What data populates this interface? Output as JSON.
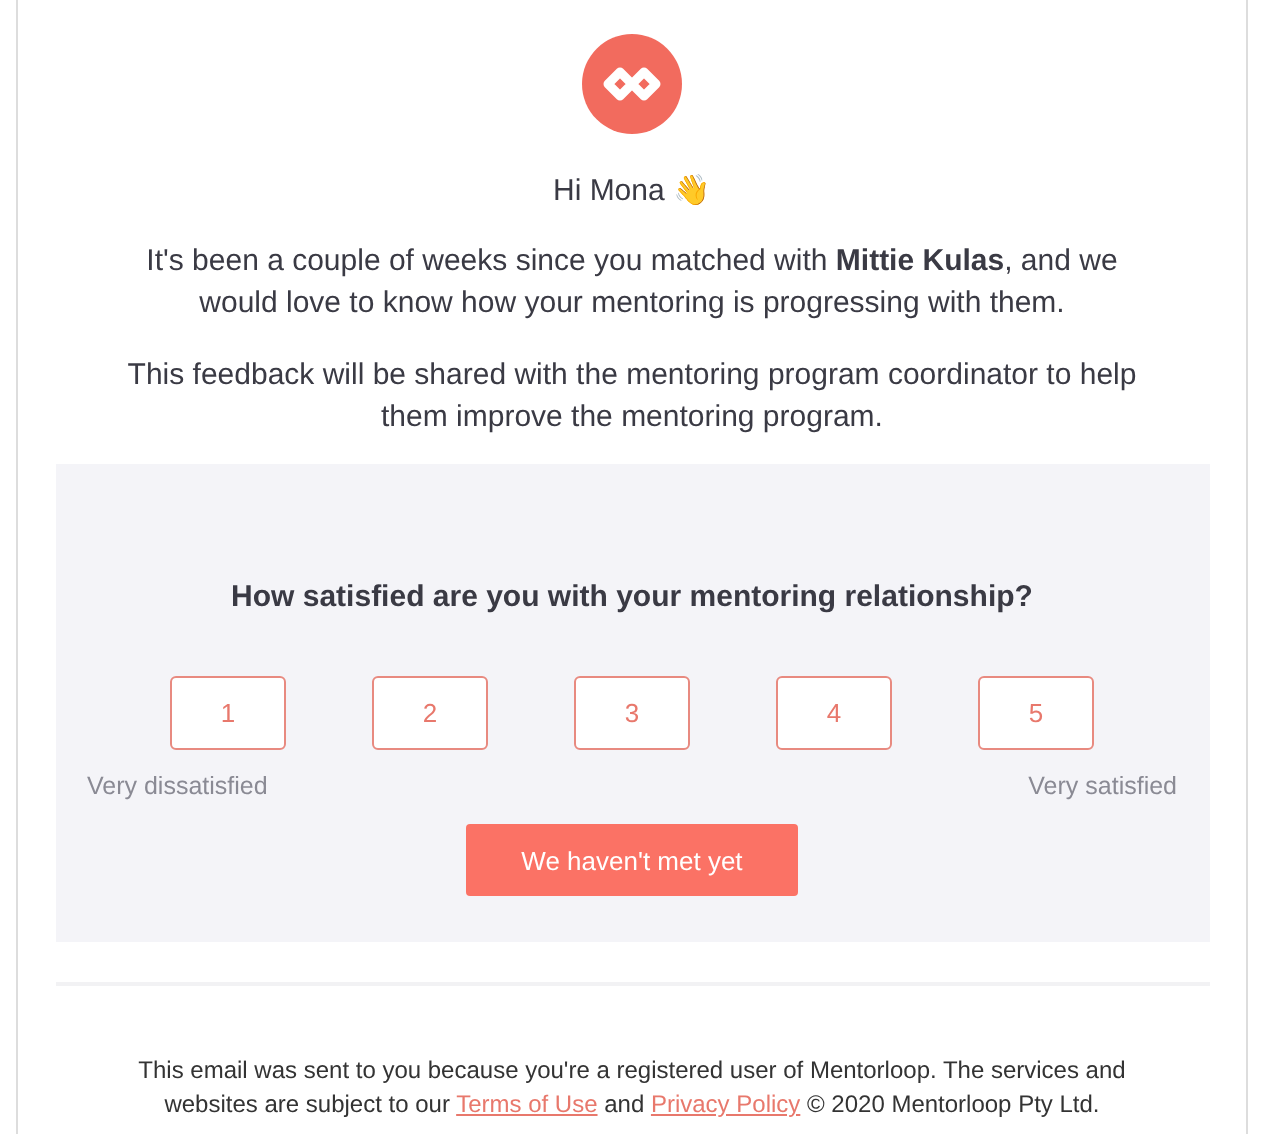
{
  "greeting": "Hi Mona 👋",
  "paragraphs": [
    "It's been a couple of weeks since you matched with **Mittie Kulas**, and we would love to know how your mentoring is progressing with them.",
    "This feedback will be shared with the mentoring program coordinator to help them improve the mentoring program."
  ],
  "survey": {
    "question": "How satisfied are you with your mentoring relationship?",
    "ratings": [
      "1",
      "2",
      "3",
      "4",
      "5"
    ],
    "low_label": "Very dissatisfied",
    "high_label": "Very satisfied",
    "not_met_button": "We haven't met yet"
  },
  "footer": {
    "text_before": "This email was sent to you because you're a registered user of Mentorloop. The services and websites are subject to our ",
    "terms_link": "Terms of Use",
    "text_middle": " and ",
    "privacy_link": "Privacy Policy",
    "text_after": " © 2020 Mentorloop Pty Ltd."
  }
}
